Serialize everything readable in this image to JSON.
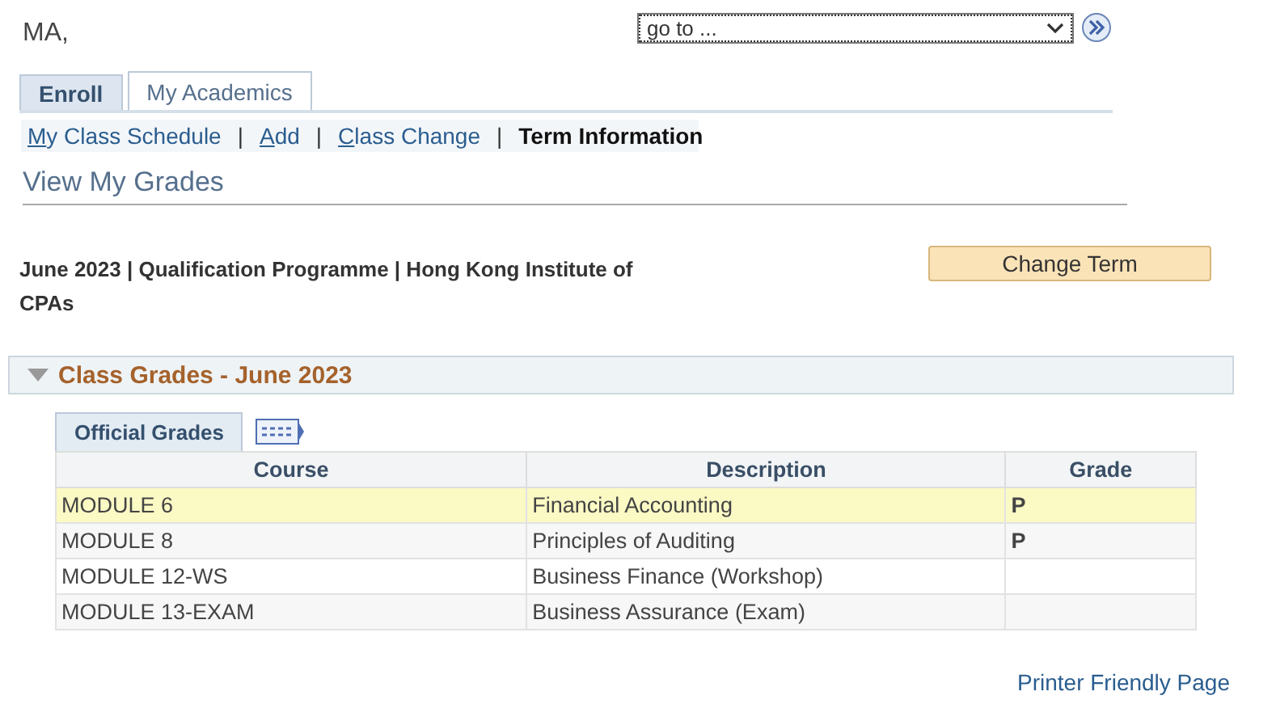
{
  "user_name": "MA,",
  "goto": {
    "value": "go to ..."
  },
  "tabs": [
    {
      "label": "Enroll",
      "selected": true
    },
    {
      "label": "My Academics",
      "selected": false
    }
  ],
  "subnav": [
    {
      "label": "My Class Schedule",
      "selected": false
    },
    {
      "label": "Add",
      "selected": false
    },
    {
      "label": "Class Change",
      "selected": false
    },
    {
      "label": "Term Information",
      "selected": true
    }
  ],
  "subnav_separator": "|",
  "page_title": "View My Grades",
  "term_info": "June 2023 | Qualification Programme | Hong Kong Institute of CPAs",
  "change_term_button": "Change Term",
  "section": {
    "title": "Class Grades - June 2023",
    "expanded": true
  },
  "grid_tab": "Official Grades",
  "table": {
    "columns": [
      "Course",
      "Description",
      "Grade"
    ],
    "rows": [
      {
        "course": "MODULE 6",
        "description": "Financial Accounting",
        "grade": "P",
        "selected": true
      },
      {
        "course": "MODULE 8",
        "description": "Principles of Auditing",
        "grade": "P",
        "selected": false
      },
      {
        "course": "MODULE 12-WS",
        "description": "Business Finance (Workshop)",
        "selected": false
      },
      {
        "course": "MODULE 13-EXAM",
        "description": "Business Assurance (Exam)",
        "selected": false
      }
    ]
  },
  "printer_link": "Printer Friendly Page"
}
